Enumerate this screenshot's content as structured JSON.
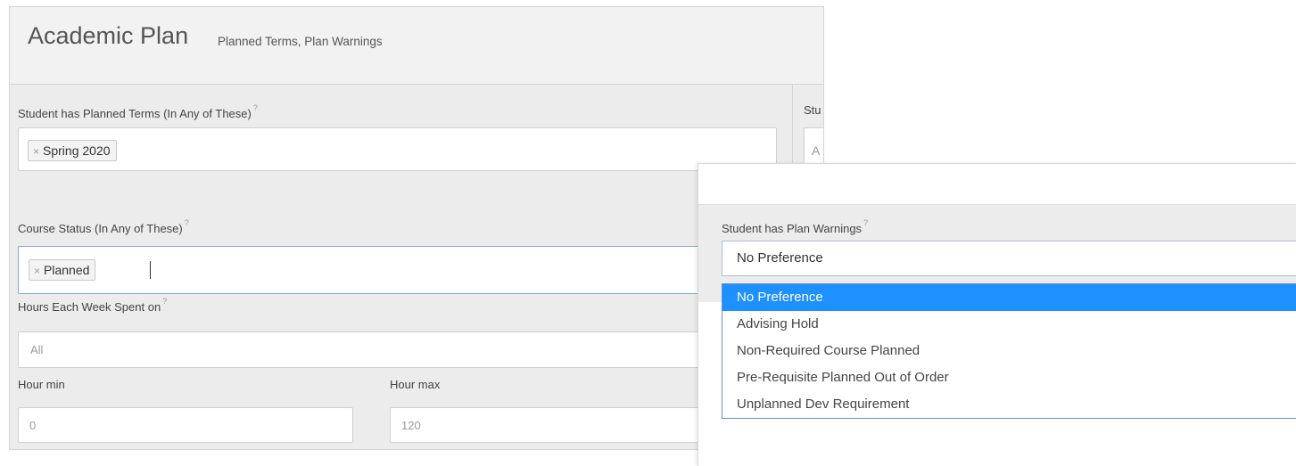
{
  "panel": {
    "title": "Academic Plan",
    "subtitle": "Planned Terms, Plan Warnings"
  },
  "planned_terms": {
    "label": "Student has Planned Terms (In Any of These)",
    "help": "?",
    "tags": [
      "Spring 2020"
    ],
    "tag_remove_icon": "×"
  },
  "right_column": {
    "label_partial": "Stu",
    "value_partial": "A"
  },
  "course_status": {
    "label": "Course Status (In Any of These)",
    "help": "?",
    "tags": [
      "Planned"
    ],
    "tag_remove_icon": "×"
  },
  "hours_week": {
    "label": "Hours Each Week Spent on",
    "help": "?",
    "value": "All"
  },
  "hour_min": {
    "label": "Hour min",
    "placeholder": "0"
  },
  "hour_max": {
    "label": "Hour max",
    "placeholder": "120"
  },
  "plan_warnings": {
    "label": "Student has Plan Warnings",
    "help": "?",
    "selected": "No Preference",
    "options": [
      "No Preference",
      "Advising Hold",
      "Non-Required Course Planned",
      "Pre-Requisite Planned Out of Order",
      "Unplanned Dev Requirement"
    ],
    "highlighted_index": 0
  },
  "colors": {
    "highlight": "#1e90ff",
    "focus_border": "#82a8d8",
    "panel_bg": "#ececec"
  }
}
